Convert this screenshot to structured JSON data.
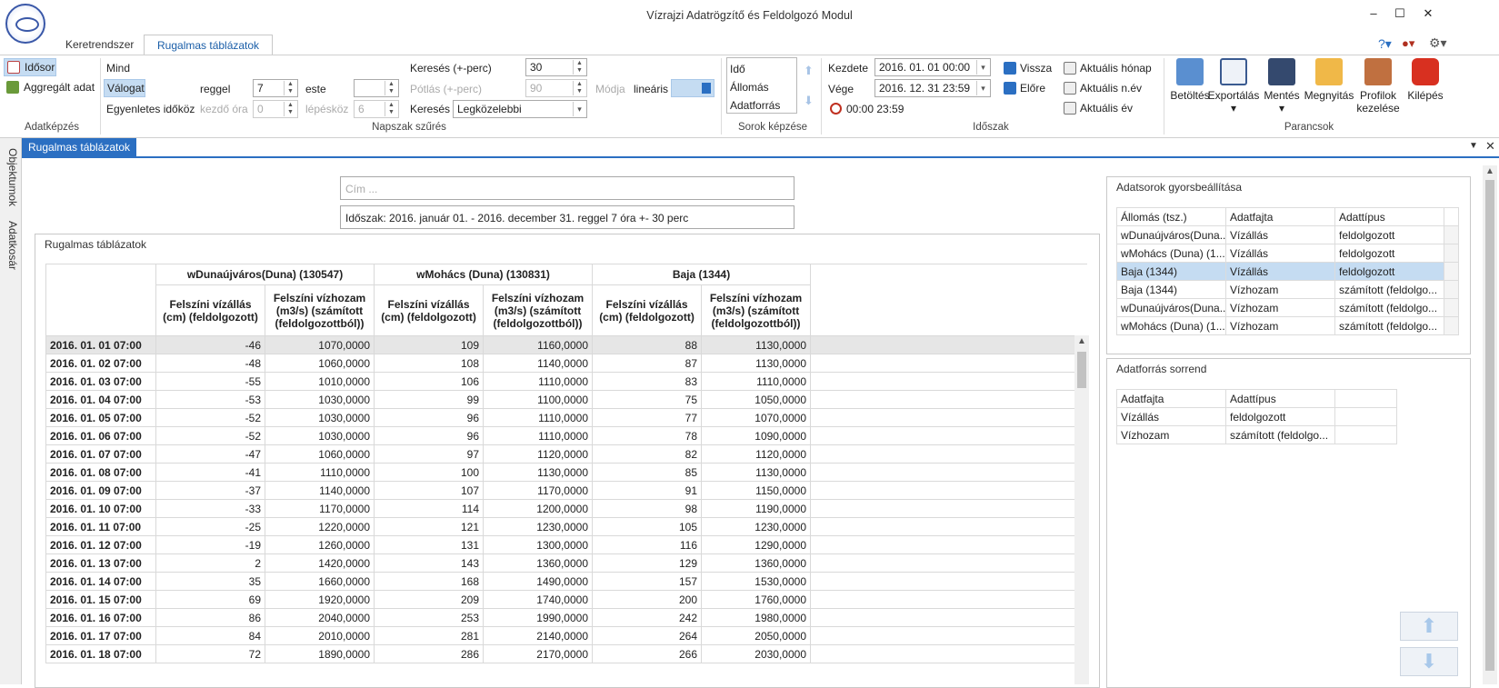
{
  "app": {
    "title": "Vízrajzi Adatrögzítő és Feldolgozó Modul"
  },
  "window": {
    "minimize": "–",
    "maximize": "☐",
    "close": "✕"
  },
  "tabs": [
    "Keretrendszer",
    "Rugalmas táblázatok"
  ],
  "ribbon": {
    "adatkepzes": {
      "group": "Adatképzés",
      "idosor": "Idősor",
      "aggregalt": "Aggregált adat"
    },
    "napszak": {
      "group": "Napszak szűrés",
      "mind": "Mind",
      "valogat": "Válogat",
      "egyenletes": "Egyenletes időköz",
      "reggel": "reggel",
      "reggel_val": "7",
      "este": "este",
      "este_val": "",
      "kezdo_ora": "kezdő óra",
      "kezdo_val": "0",
      "lepeskoz": "lépésköz",
      "lepeskoz_val": "6",
      "kereses_perc": "Keresés (+-perc)",
      "kereses_perc_val": "30",
      "potlas": "Pótlás (+-perc)",
      "potlas_val": "90",
      "modja": "Módja",
      "linearis": "lineáris",
      "kereses": "Keresés",
      "kereses_val": "Legközelebbi"
    },
    "sorok": {
      "group": "Sorok képzése",
      "items": [
        "Idő",
        "Állomás",
        "Adatforrás"
      ]
    },
    "idoszak": {
      "group": "Időszak",
      "kezdete": "Kezdete",
      "kezdete_val": "2016. 01. 01 00:00",
      "vege": "Vége",
      "vege_val": "2016. 12. 31 23:59",
      "time": "00:00 23:59",
      "vissza": "Vissza",
      "elore": "Előre",
      "honap": "Aktuális hónap",
      "nev": "Aktuális n.év",
      "ev": "Aktuális év"
    },
    "parancsok": {
      "group": "Parancsok",
      "betoltes": "Betöltés",
      "exportalas": "Exportálás",
      "mentes": "Mentés",
      "megnyitas": "Megnyitás",
      "profilok1": "Profilok",
      "profilok2": "kezelése",
      "kilepes": "Kilépés"
    }
  },
  "side_tabs": [
    "Objektumok",
    "Adatkosár"
  ],
  "doc_tab": "Rugalmas táblázatok",
  "cim_placeholder": "Cím ...",
  "idoszak_text": "Időszak: 2016. január 01. - 2016. december 31. reggel 7 óra +- 30 perc",
  "table_panel_title": "Rugalmas táblázatok",
  "stations": [
    "wDunaújváros(Duna) (130547)",
    "wMohács (Duna) (130831)",
    "Baja (1344)"
  ],
  "col_a": [
    "Felszíni vízállás",
    "(cm) (feldolgozott)"
  ],
  "col_b": [
    "Felszíni vízhozam",
    "(m3/s) (számított",
    "(feldolgozottból))"
  ],
  "rows": [
    [
      "2016. 01. 01 07:00",
      "-46",
      "1070,0000",
      "109",
      "1160,0000",
      "88",
      "1130,0000"
    ],
    [
      "2016. 01. 02 07:00",
      "-48",
      "1060,0000",
      "108",
      "1140,0000",
      "87",
      "1130,0000"
    ],
    [
      "2016. 01. 03 07:00",
      "-55",
      "1010,0000",
      "106",
      "1110,0000",
      "83",
      "1110,0000"
    ],
    [
      "2016. 01. 04 07:00",
      "-53",
      "1030,0000",
      "99",
      "1100,0000",
      "75",
      "1050,0000"
    ],
    [
      "2016. 01. 05 07:00",
      "-52",
      "1030,0000",
      "96",
      "1110,0000",
      "77",
      "1070,0000"
    ],
    [
      "2016. 01. 06 07:00",
      "-52",
      "1030,0000",
      "96",
      "1110,0000",
      "78",
      "1090,0000"
    ],
    [
      "2016. 01. 07 07:00",
      "-47",
      "1060,0000",
      "97",
      "1120,0000",
      "82",
      "1120,0000"
    ],
    [
      "2016. 01. 08 07:00",
      "-41",
      "1110,0000",
      "100",
      "1130,0000",
      "85",
      "1130,0000"
    ],
    [
      "2016. 01. 09 07:00",
      "-37",
      "1140,0000",
      "107",
      "1170,0000",
      "91",
      "1150,0000"
    ],
    [
      "2016. 01. 10 07:00",
      "-33",
      "1170,0000",
      "114",
      "1200,0000",
      "98",
      "1190,0000"
    ],
    [
      "2016. 01. 11 07:00",
      "-25",
      "1220,0000",
      "121",
      "1230,0000",
      "105",
      "1230,0000"
    ],
    [
      "2016. 01. 12 07:00",
      "-19",
      "1260,0000",
      "131",
      "1300,0000",
      "116",
      "1290,0000"
    ],
    [
      "2016. 01. 13 07:00",
      "2",
      "1420,0000",
      "143",
      "1360,0000",
      "129",
      "1360,0000"
    ],
    [
      "2016. 01. 14 07:00",
      "35",
      "1660,0000",
      "168",
      "1490,0000",
      "157",
      "1530,0000"
    ],
    [
      "2016. 01. 15 07:00",
      "69",
      "1920,0000",
      "209",
      "1740,0000",
      "200",
      "1760,0000"
    ],
    [
      "2016. 01. 16 07:00",
      "86",
      "2040,0000",
      "253",
      "1990,0000",
      "242",
      "1980,0000"
    ],
    [
      "2016. 01. 17 07:00",
      "84",
      "2010,0000",
      "281",
      "2140,0000",
      "264",
      "2050,0000"
    ],
    [
      "2016. 01. 18 07:00",
      "72",
      "1890,0000",
      "286",
      "2170,0000",
      "266",
      "2030,0000"
    ]
  ],
  "quick": {
    "title": "Adatsorok gyorsbeállítása",
    "headers": [
      "Állomás (tsz.)",
      "Adatfajta",
      "Adattípus"
    ],
    "rows": [
      [
        "wDunaújváros(Duna...",
        "Vízállás",
        "feldolgozott"
      ],
      [
        "wMohács (Duna) (1...",
        "Vízállás",
        "feldolgozott"
      ],
      [
        "Baja (1344)",
        "Vízállás",
        "feldolgozott"
      ],
      [
        "Baja (1344)",
        "Vízhozam",
        "számított (feldolgo..."
      ],
      [
        "wDunaújváros(Duna...",
        "Vízhozam",
        "számított (feldolgo..."
      ],
      [
        "wMohács (Duna) (1...",
        "Vízhozam",
        "számított (feldolgo..."
      ]
    ]
  },
  "order": {
    "title": "Adatforrás sorrend",
    "headers": [
      "Adatfajta",
      "Adattípus"
    ],
    "rows": [
      [
        "Vízállás",
        "feldolgozott"
      ],
      [
        "Vízhozam",
        "számított (feldolgo..."
      ]
    ]
  }
}
